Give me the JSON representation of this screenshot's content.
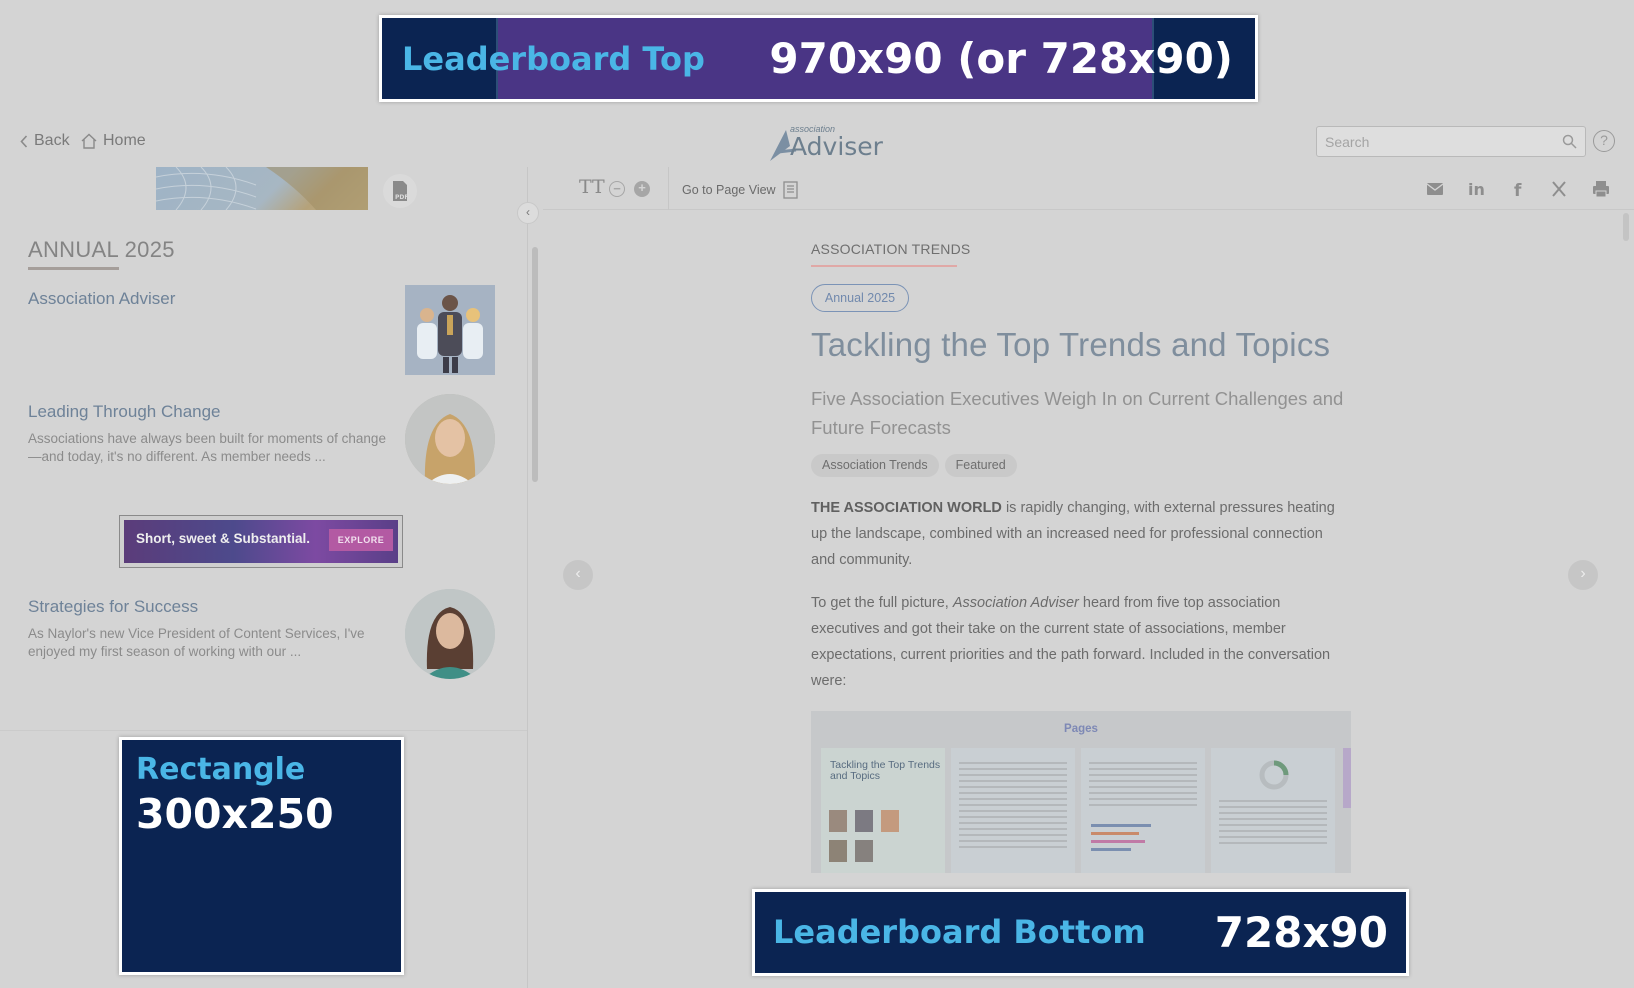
{
  "ads": {
    "top": {
      "label": "Leaderboard Top",
      "size": "970x90 (or 728x90)"
    },
    "rectangle": {
      "label": "Rectangle",
      "size": "300x250"
    },
    "bottom": {
      "label": "Leaderboard Bottom",
      "size": "728x90"
    },
    "sidebar_promo": {
      "text": "Short, sweet & Substantial.",
      "cta": "EXPLORE"
    }
  },
  "header": {
    "back_label": "Back",
    "home_label": "Home",
    "logo_small": "association",
    "logo_big": "Adviser",
    "search_placeholder": "Search",
    "help_label": "?"
  },
  "sidebar": {
    "section_title": "ANNUAL 2025",
    "articles": [
      {
        "title": "Association Adviser",
        "description": ""
      },
      {
        "title": "Leading Through Change",
        "description": "Associations have always been built for moments of change—and today, it's no different. As member needs ..."
      },
      {
        "title": "Strategies for Success",
        "description": "As Naylor's new Vice President of Content Services, I've enjoyed my first season of working with our ..."
      }
    ]
  },
  "toolbar": {
    "text_size_label": "TT",
    "goto_page_view": "Go to Page View",
    "share_icons": [
      "email-icon",
      "linkedin-icon",
      "facebook-icon",
      "x-icon",
      "print-icon"
    ]
  },
  "article": {
    "category": "ASSOCIATION TRENDS",
    "issue": "Annual 2025",
    "title": "Tackling the Top Trends and Topics",
    "subtitle": "Five Association Executives Weigh In on Current Challenges and Future Forecasts",
    "tags": [
      "Association Trends",
      "Featured"
    ],
    "para1_lead": "THE ASSOCIATION WORLD",
    "para1_rest": " is rapidly changing, with external pressures heating up the landscape, combined with an increased need for professional connection and community.",
    "para2_a": "To get the full picture, ",
    "para2_em": "Association Adviser",
    "para2_b": " heard from five top association executives and got their take on the current state of associations, member expectations, current priorities and the path forward. Included in the conversation were:",
    "pages_label": "Pages",
    "page1_title": "Tackling the Top Trends and Topics"
  },
  "colors": {
    "ad_navy": "#0b2452",
    "ad_cyan": "#4ab6e6",
    "ad_purple": "#4a3585",
    "overlay_grey": "#d4d4d4"
  }
}
